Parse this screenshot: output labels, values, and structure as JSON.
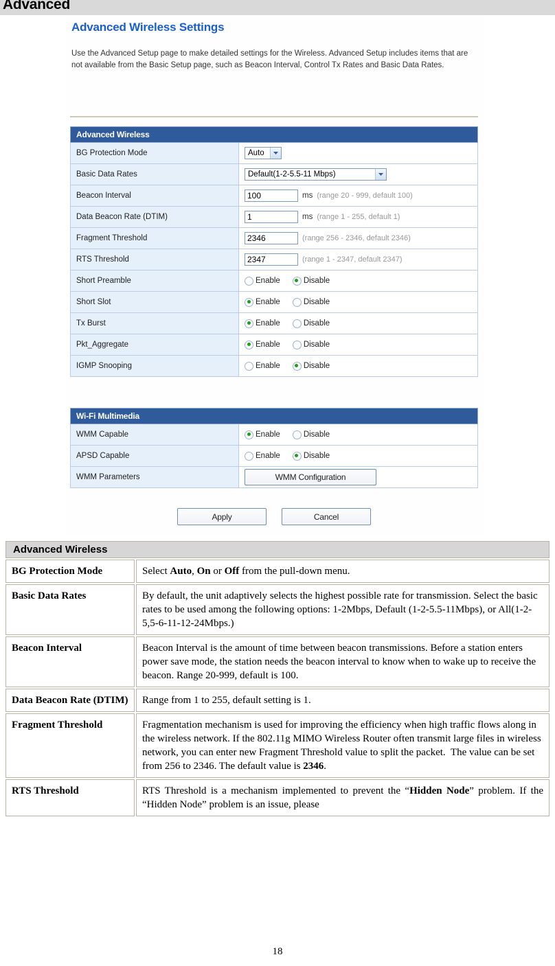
{
  "header": {
    "title": "Advanced"
  },
  "screenshot": {
    "title": "Advanced Wireless Settings",
    "description": "Use the Advanced Setup page to make detailed settings for the Wireless. Advanced Setup includes items that are not available from the Basic Setup page, such as Beacon Interval, Control Tx Rates and Basic Data Rates.",
    "advanced_wireless": {
      "section_title": "Advanced Wireless",
      "rows": {
        "bg_protection_mode": {
          "label": "BG Protection Mode",
          "value": "Auto"
        },
        "basic_data_rates": {
          "label": "Basic Data Rates",
          "value": "Default(1-2-5.5-11 Mbps)"
        },
        "beacon_interval": {
          "label": "Beacon Interval",
          "value": "100",
          "unit": "ms",
          "hint": "(range 20 - 999, default 100)"
        },
        "dtim": {
          "label": "Data Beacon Rate (DTIM)",
          "value": "1",
          "unit": "ms",
          "hint": "(range 1 - 255, default 1)"
        },
        "fragment_threshold": {
          "label": "Fragment Threshold",
          "value": "2346",
          "unit": "",
          "hint": "(range 256 - 2346, default 2346)"
        },
        "rts_threshold": {
          "label": "RTS Threshold",
          "value": "2347",
          "unit": "",
          "hint": "(range 1 - 2347, default 2347)"
        },
        "short_preamble": {
          "label": "Short Preamble",
          "enable_label": "Enable",
          "disable_label": "Disable",
          "selected": "Disable"
        },
        "short_slot": {
          "label": "Short Slot",
          "enable_label": "Enable",
          "disable_label": "Disable",
          "selected": "Enable"
        },
        "tx_burst": {
          "label": "Tx Burst",
          "enable_label": "Enable",
          "disable_label": "Disable",
          "selected": "Enable"
        },
        "pkt_aggregate": {
          "label": "Pkt_Aggregate",
          "enable_label": "Enable",
          "disable_label": "Disable",
          "selected": "Enable"
        },
        "igmp_snooping": {
          "label": "IGMP Snooping",
          "enable_label": "Enable",
          "disable_label": "Disable",
          "selected": "Disable"
        }
      }
    },
    "wifi_multimedia": {
      "section_title": "Wi-Fi Multimedia",
      "rows": {
        "wmm_capable": {
          "label": "WMM Capable",
          "enable_label": "Enable",
          "disable_label": "Disable",
          "selected": "Enable"
        },
        "apsd_capable": {
          "label": "APSD Capable",
          "enable_label": "Enable",
          "disable_label": "Disable",
          "selected": "Disable"
        },
        "wmm_parameters": {
          "label": "WMM Parameters",
          "button_label": "WMM Configuration"
        }
      }
    },
    "buttons": {
      "apply": "Apply",
      "cancel": "Cancel"
    },
    "colors": {
      "section_header_bg": "#2f5b9c",
      "label_cell_bg": "#e6f0fa",
      "title_color": "#1a5fd0",
      "radio_selected": "#19a019"
    }
  },
  "doc_table": {
    "header": "Advanced Wireless",
    "rows": [
      {
        "term": "BG Protection Mode",
        "definition_html": "Select <b>Auto</b>, <b>On</b> or <b>Off</b> from the pull-down menu."
      },
      {
        "term": "Basic Data Rates",
        "definition_html": "By default, the unit adaptively selects the highest possible rate for transmission. Select the basic rates to be used among the following options: 1-2Mbps, Default (1-2-5.5-11Mbps), or All(1-2-5,5-6-11-12-24Mbps.)"
      },
      {
        "term": "Beacon Interval",
        "definition_html": "Beacon Interval is the amount of time between beacon transmissions. Before a station enters power save mode, the station needs the beacon interval to know when to wake up to receive the beacon. Range 20-999, default is 100."
      },
      {
        "term": "Data Beacon Rate (DTIM)",
        "definition_html": "Range from 1 to 255, default setting is 1."
      },
      {
        "term": "Fragment Threshold",
        "definition_html": "Fragmentation mechanism is used for improving the efficiency when high traffic flows along in the wireless network. If the 802.11g MIMO Wireless Router often transmit large files in wireless network, you can enter new Fragment Threshold value to split the packet.&nbsp; The value can be set from 256 to 2346. The default value is <b>2346</b>."
      },
      {
        "term": "RTS Threshold",
        "definition_html": "RTS Threshold is a mechanism implemented to prevent the &ldquo;<b>Hidden Node</b>&rdquo; problem. If the &ldquo;Hidden Node&rdquo; problem is an issue, please"
      }
    ]
  },
  "footer": {
    "page_number": "18"
  }
}
